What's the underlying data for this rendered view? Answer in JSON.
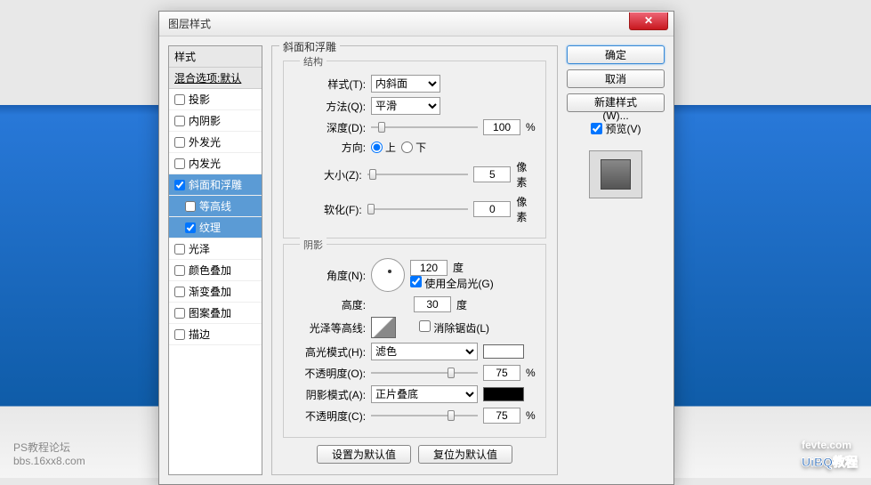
{
  "dialog": {
    "title": "图层样式"
  },
  "styleList": {
    "header": "样式",
    "blendHeader": "混合选项:默认",
    "items": [
      {
        "label": "投影",
        "checked": false
      },
      {
        "label": "内阴影",
        "checked": false
      },
      {
        "label": "外发光",
        "checked": false
      },
      {
        "label": "内发光",
        "checked": false
      },
      {
        "label": "斜面和浮雕",
        "checked": true,
        "selected": true
      },
      {
        "label": "等高线",
        "checked": false,
        "sub": true,
        "selected": true
      },
      {
        "label": "纹理",
        "checked": true,
        "sub": true,
        "selected": true
      },
      {
        "label": "光泽",
        "checked": false
      },
      {
        "label": "颜色叠加",
        "checked": false
      },
      {
        "label": "渐变叠加",
        "checked": false
      },
      {
        "label": "图案叠加",
        "checked": false
      },
      {
        "label": "描边",
        "checked": false
      }
    ]
  },
  "bevel": {
    "title": "斜面和浮雕",
    "structure": {
      "groupLabel": "结构",
      "styleLabel": "样式(T):",
      "styleValue": "内斜面",
      "techniqueLabel": "方法(Q):",
      "techniqueValue": "平滑",
      "depthLabel": "深度(D):",
      "depthValue": "100",
      "depthUnit": "%",
      "directionLabel": "方向:",
      "up": "上",
      "down": "下",
      "sizeLabel": "大小(Z):",
      "sizeValue": "5",
      "sizeUnit": "像素",
      "softenLabel": "软化(F):",
      "softenValue": "0",
      "softenUnit": "像素"
    },
    "shading": {
      "groupLabel": "阴影",
      "angleLabel": "角度(N):",
      "angleValue": "120",
      "angleUnit": "度",
      "globalLabel": "使用全局光(G)",
      "altitudeLabel": "高度:",
      "altitudeValue": "30",
      "altitudeUnit": "度",
      "glossLabel": "光泽等高线:",
      "antiAlias": "消除锯齿(L)",
      "highlightModeLabel": "高光模式(H):",
      "highlightModeValue": "滤色",
      "highlightColor": "#ffffff",
      "highlightOpacityLabel": "不透明度(O):",
      "highlightOpacityValue": "75",
      "opacityUnit": "%",
      "shadowModeLabel": "阴影模式(A):",
      "shadowModeValue": "正片叠底",
      "shadowColor": "#000000",
      "shadowOpacityLabel": "不透明度(C):",
      "shadowOpacityValue": "75"
    },
    "buttons": {
      "setDefault": "设置为默认值",
      "resetDefault": "复位为默认值"
    }
  },
  "rightPanel": {
    "ok": "确定",
    "cancel": "取消",
    "newStyle": "新建样式(W)...",
    "preview": "预览(V)"
  },
  "bg": {
    "leftText1": "PS教程论坛",
    "leftText2": "bbs.16xx8.com",
    "logo1": "fevte.com",
    "logo2": "UiBQ教程"
  }
}
